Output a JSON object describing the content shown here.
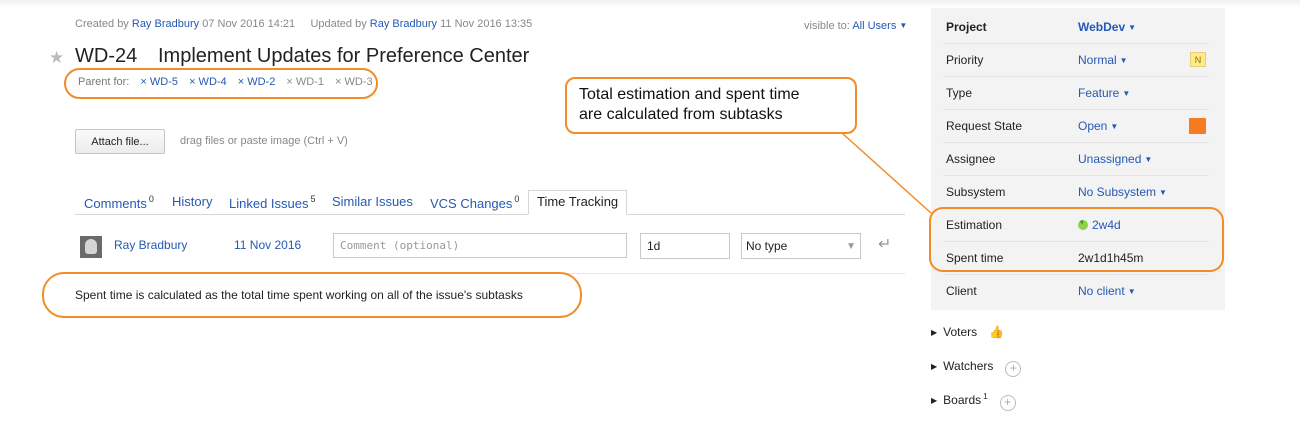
{
  "header": {
    "created_prefix": "Created by",
    "created_by": "Ray Bradbury",
    "created_at": "07 Nov 2016 14:21",
    "updated_prefix": "Updated by",
    "updated_by": "Ray Bradbury",
    "updated_at": "11 Nov 2016 13:35",
    "visible_label": "visible to:",
    "visible_value": "All Users",
    "star": "★",
    "issue_id": "WD-24",
    "title": "Implement Updates for Preference Center"
  },
  "parent": {
    "label": "Parent for:",
    "chips": [
      "× WD-5",
      "× WD-4",
      "× WD-2",
      "× WD-1",
      "× WD-3"
    ]
  },
  "attach": {
    "button": "Attach file...",
    "hint": "drag files or paste image (Ctrl + V)"
  },
  "tabs": [
    {
      "label": "Comments",
      "count": "0"
    },
    {
      "label": "History",
      "count": ""
    },
    {
      "label": "Linked Issues",
      "count": "5"
    },
    {
      "label": "Similar Issues",
      "count": ""
    },
    {
      "label": "VCS Changes",
      "count": "0"
    },
    {
      "label": "Time Tracking",
      "count": ""
    }
  ],
  "time_tracking": {
    "user": "Ray Bradbury",
    "date": "11 Nov 2016",
    "comment_placeholder": "Comment (optional)",
    "time_value": "1d",
    "type_value": "No type",
    "submit_icon": "↵"
  },
  "annotations": {
    "spent_note": "Spent time is calculated as the total time spent working on all of the issue's subtasks",
    "estimation_note_line1": "Total estimation and spent time",
    "estimation_note_line2": "are calculated from subtasks",
    "color": "#f28c28"
  },
  "fields": [
    {
      "label": "Project",
      "value": "WebDev"
    },
    {
      "label": "Priority",
      "value": "Normal",
      "badge": "N"
    },
    {
      "label": "Type",
      "value": "Feature"
    },
    {
      "label": "Request State",
      "value": "Open"
    },
    {
      "label": "Assignee",
      "value": "Unassigned"
    },
    {
      "label": "Subsystem",
      "value": "No Subsystem"
    },
    {
      "label": "Estimation",
      "value": "2w4d"
    },
    {
      "label": "Spent time",
      "value": "2w1d1h45m"
    },
    {
      "label": "Client",
      "value": "No client"
    }
  ],
  "side_sections": {
    "voters": "Voters",
    "watchers": "Watchers",
    "boards": "Boards",
    "boards_count": "1"
  },
  "colors": {
    "link": "#2459b5",
    "accent_orange": "#f28c28",
    "state_orange": "#f47b20",
    "priority_badge": "#ffe98a"
  }
}
